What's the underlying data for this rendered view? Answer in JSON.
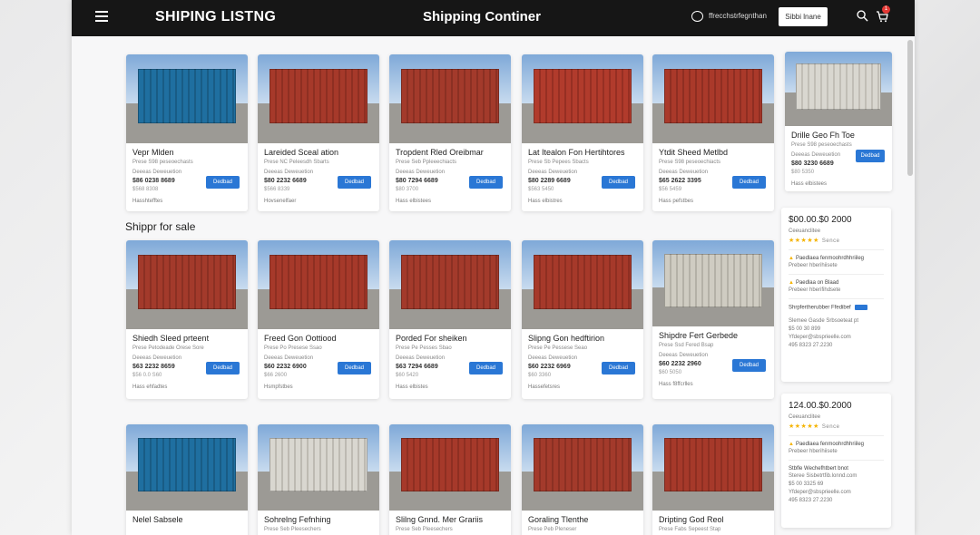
{
  "topbar": {
    "brand": "SHIPING LISTNG",
    "title": "Shipping Continer",
    "email": "ffrecchstrfegnthan",
    "signin": "Sibbi lnane",
    "cart_count": "1"
  },
  "section_heading": "Shippr for sale",
  "colors": {
    "topbar": "#161616",
    "button": "#2a77d5",
    "star": "#f5b400"
  },
  "rows": [
    [
      {
        "title": "Vepr Mlden",
        "sub": "Prese S98 peseoechasts",
        "meta": "Deeeas Deweuetion",
        "price": "$86 0238 8689",
        "spec": "$568 8308",
        "loc": "Hasshtefftes",
        "btn": "Dedbad",
        "color": "#1f6fa0",
        "color2": "#195c85"
      },
      {
        "title": "Lareided Sceal ation",
        "sub": "Prese NC Peleesdh Sbarts",
        "meta": "Deeeas Deweuetion",
        "price": "$80 2232 6689",
        "spec": "$566 8339",
        "loc": "Hovsenelfaer",
        "btn": "Dedbad",
        "color": "#a6392a",
        "color2": "#8e2f22"
      },
      {
        "title": "Tropdent Rled Oreibmar",
        "sub": "Prese Seb Ppleeechiacts",
        "meta": "Deeeas Deweuetion",
        "price": "$80 7294 6689",
        "spec": "$80 3700",
        "loc": "Hass elbistees",
        "btn": "Dedbad",
        "color": "#a33a2b",
        "color2": "#8b3023"
      },
      {
        "title": "Lat Itealon Fon Hertihtores",
        "sub": "Prese Sb Pepees Sbacts",
        "meta": "Deeeas Deweuetion",
        "price": "$80 2289 6689",
        "spec": "$563 5450",
        "loc": "Hass elbistres",
        "btn": "Dedbad",
        "color": "#b13b2c",
        "color2": "#962f23"
      },
      {
        "title": "Ytdit Sheed Metlbd",
        "sub": "Prese S98 peseoechiacts",
        "meta": "Deeeas Deweuetion",
        "price": "$65 2622 3395",
        "spec": "$56 5459",
        "loc": "Hass pefstbes",
        "btn": "Dedbad",
        "color": "#aa392a",
        "color2": "#8f2e22"
      }
    ],
    [
      {
        "title": "Shiedh Sleed prteent",
        "sub": "Prese Petodeade Orese Sore",
        "meta": "Deeeas Deweuetion",
        "price": "$63 2232 8659",
        "spec": "$56 0.0 S60",
        "loc": "Hass ehfadtes",
        "btn": "Dedbad",
        "color": "#a33a2b",
        "color2": "#8b3023"
      },
      {
        "title": "Freed Gon Oottiood",
        "sub": "Prese Po Presese Ssao",
        "meta": "Deeeas Deweuetion",
        "price": "$60 2232 6900",
        "spec": "$66 2600",
        "loc": "Hsmpfstbes",
        "btn": "Dedbad",
        "color": "#a6392a",
        "color2": "#8e2f22"
      },
      {
        "title": "Porded For sheiken",
        "sub": "Prese Pe Pesses Sbao",
        "meta": "Deeeas Deweuetion",
        "price": "$63 7294 6689",
        "spec": "$60 5420",
        "loc": "Hass elbistes",
        "btn": "Dedbad",
        "color": "#a33a2b",
        "color2": "#8b3023"
      },
      {
        "title": "Slipng Gon hedftirion",
        "sub": "Prese Pe Pessese Seao",
        "meta": "Deeeas Deweuetion",
        "price": "$60 2232 6969",
        "spec": "$60 3360",
        "loc": "Hassefetsres",
        "btn": "Dedbad",
        "color": "#a6392a",
        "color2": "#8e2f22"
      },
      {
        "title": "Shipdre Fert Gerbede",
        "sub": "Prese Ssd Fered Bsap",
        "meta": "Deeeas Deweuetion",
        "price": "$60 2232 2960",
        "spec": "$60 5050",
        "loc": "Hass f8ffcrlles",
        "btn": "Dedbad",
        "color": "#cfccc2",
        "color2": "#b4b1a7"
      }
    ],
    [
      {
        "title": "Nelel Sabsele",
        "sub": "",
        "meta": "",
        "price": "",
        "spec": "",
        "loc": "",
        "btn": "",
        "color": "#1f6fa0",
        "color2": "#195c85"
      },
      {
        "title": "Sohrelng Fefnhing",
        "sub": "Prese Seb Pleesechers",
        "meta": "",
        "price": "",
        "spec": "",
        "loc": "",
        "btn": "",
        "color": "#d9d7d0",
        "color2": "#bdbab2"
      },
      {
        "title": "Slilng Gnnd. Mer Grariis",
        "sub": "Prese Seb Pleesechers",
        "meta": "",
        "price": "",
        "spec": "",
        "loc": "",
        "btn": "",
        "color": "#a6392a",
        "color2": "#8e2f22"
      },
      {
        "title": "Goraling Tlenthe",
        "sub": "Prese Peb Pleneser",
        "meta": "",
        "price": "",
        "spec": "",
        "loc": "",
        "btn": "",
        "color": "#a33a2b",
        "color2": "#8b3023"
      },
      {
        "title": "Dripting God Reol",
        "sub": "Prese Fabs Sepeest Stap",
        "meta": "",
        "price": "",
        "spec": "",
        "loc": "",
        "btn": "",
        "color": "#a6392a",
        "color2": "#8e2f22"
      }
    ]
  ],
  "side_card": {
    "title": "Drille Geo Fh Toe",
    "sub": "Prese S98 peseoechasts",
    "meta": "Deeeas Deweuetion",
    "price": "$80 3230 6689",
    "spec": "$80 5350",
    "loc": "Hass elbistees",
    "btn": "Dedbad"
  },
  "price_panels": [
    {
      "price": "$00.00.$0 2000",
      "sub": "Ceeuanclitee",
      "stars": "★★★★★",
      "stars_label": "Sence",
      "note1": "Paedlaea fenmoohrdhhriileg",
      "note1_sub": "Prebeer hberihiisete",
      "note2": "Paedlaa on Blaad",
      "note2_sub": "Prebeer hberifihdsete",
      "contact_head": "Shrpfertherubber Ffedibef",
      "contact1": "Slemee Gasde Srbsoeteat pt",
      "contact2": "$5 00 30 899",
      "contact3": "Yfdeper@sbsprieelle.com",
      "contact4": "495 8323 27.2230"
    },
    {
      "price": "124.00.$0.2000",
      "sub": "Ceeuanclitee",
      "stars": "★★★★★",
      "stars_label": "Sence",
      "note1": "Paedlaea fenmoohrdhhriileg",
      "note1_sub": "Prebeer hberihiisete",
      "contact_head": "Stbfle Wechefhtbert bnot",
      "contact1": "Steree Sisbetrtfib.lonnd.com",
      "contact2": "$5 00 3325 69",
      "contact3": "Yfdeper@sbsprieelle.com",
      "contact4": "495 8323 27.2230"
    }
  ]
}
